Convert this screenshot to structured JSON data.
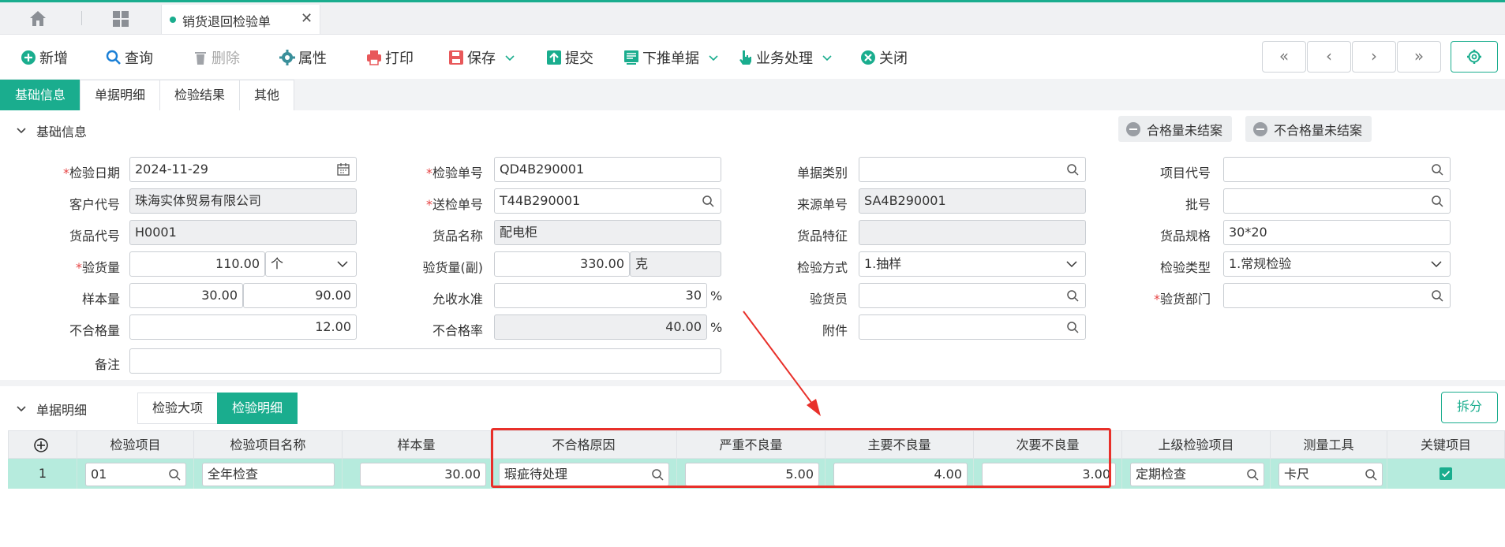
{
  "tabbar": {
    "doc_tab": "销货退回检验单"
  },
  "toolbar": {
    "new": "新增",
    "query": "查询",
    "delete": "删除",
    "properties": "属性",
    "print": "打印",
    "save": "保存",
    "submit": "提交",
    "push_down": "下推单据",
    "business": "业务处理",
    "close": "关闭"
  },
  "subtabs": [
    "基础信息",
    "单据明细",
    "检验结果",
    "其他"
  ],
  "basic": {
    "section_title": "基础信息",
    "pill_qualified": "合格量未结案",
    "pill_unqualified": "不合格量未结案",
    "fields": {
      "inspect_date": {
        "label": "检验日期",
        "value": "2024-11-29"
      },
      "inspect_no": {
        "label": "检验单号",
        "value": "QD4B290001"
      },
      "doc_type": {
        "label": "单据类别",
        "value": ""
      },
      "project_code": {
        "label": "项目代号",
        "value": ""
      },
      "customer_code": {
        "label": "客户代号",
        "value": "珠海实体贸易有限公司"
      },
      "send_no": {
        "label": "送检单号",
        "value": "T44B290001"
      },
      "source_no": {
        "label": "来源单号",
        "value": "SA4B290001"
      },
      "batch_no": {
        "label": "批号",
        "value": ""
      },
      "goods_code": {
        "label": "货品代号",
        "value": "H0001"
      },
      "goods_name": {
        "label": "货品名称",
        "value": "配电柜"
      },
      "goods_feature": {
        "label": "货品特征",
        "value": ""
      },
      "goods_spec": {
        "label": "货品规格",
        "value": "30*20"
      },
      "inspect_qty": {
        "label": "验货量",
        "value": "110.00",
        "unit": "个"
      },
      "inspect_qty2": {
        "label": "验货量(副)",
        "value": "330.00",
        "unit": "克"
      },
      "inspect_method": {
        "label": "检验方式",
        "value": "1.抽样"
      },
      "inspect_type": {
        "label": "检验类型",
        "value": "1.常规检验"
      },
      "sample_qty": {
        "label": "样本量",
        "value1": "30.00",
        "value2": "90.00"
      },
      "accept_level": {
        "label": "允收水准",
        "value": "30",
        "unit": "%"
      },
      "inspector": {
        "label": "验货员",
        "value": ""
      },
      "inspect_dept": {
        "label": "验货部门",
        "value": ""
      },
      "unqualified_qty": {
        "label": "不合格量",
        "value": "12.00"
      },
      "unqualified_rate": {
        "label": "不合格率",
        "value": "40.00",
        "unit": "%"
      },
      "attachment": {
        "label": "附件",
        "value": ""
      },
      "remark": {
        "label": "备注",
        "value": ""
      }
    }
  },
  "detail": {
    "section_title": "单据明细",
    "tabs": [
      "检验大项",
      "检验明细"
    ],
    "split_button": "拆分",
    "columns": [
      "检验项目",
      "检验项目名称",
      "样本量",
      "不合格原因",
      "严重不良量",
      "主要不良量",
      "次要不良量",
      "上级检验项目",
      "测量工具",
      "关键项目"
    ],
    "rows": [
      {
        "no": "1",
        "item": "01",
        "item_name": "全年检查",
        "sample": "30.00",
        "reason": "瑕疵待处理",
        "critical": "5.00",
        "major": "4.00",
        "minor": "3.00",
        "parent": "定期检查",
        "tool": "卡尺",
        "key": true
      }
    ]
  },
  "colors": {
    "accent": "#1aad8e",
    "highlight": "#e8302a",
    "row_selected": "#b6ebdd"
  }
}
